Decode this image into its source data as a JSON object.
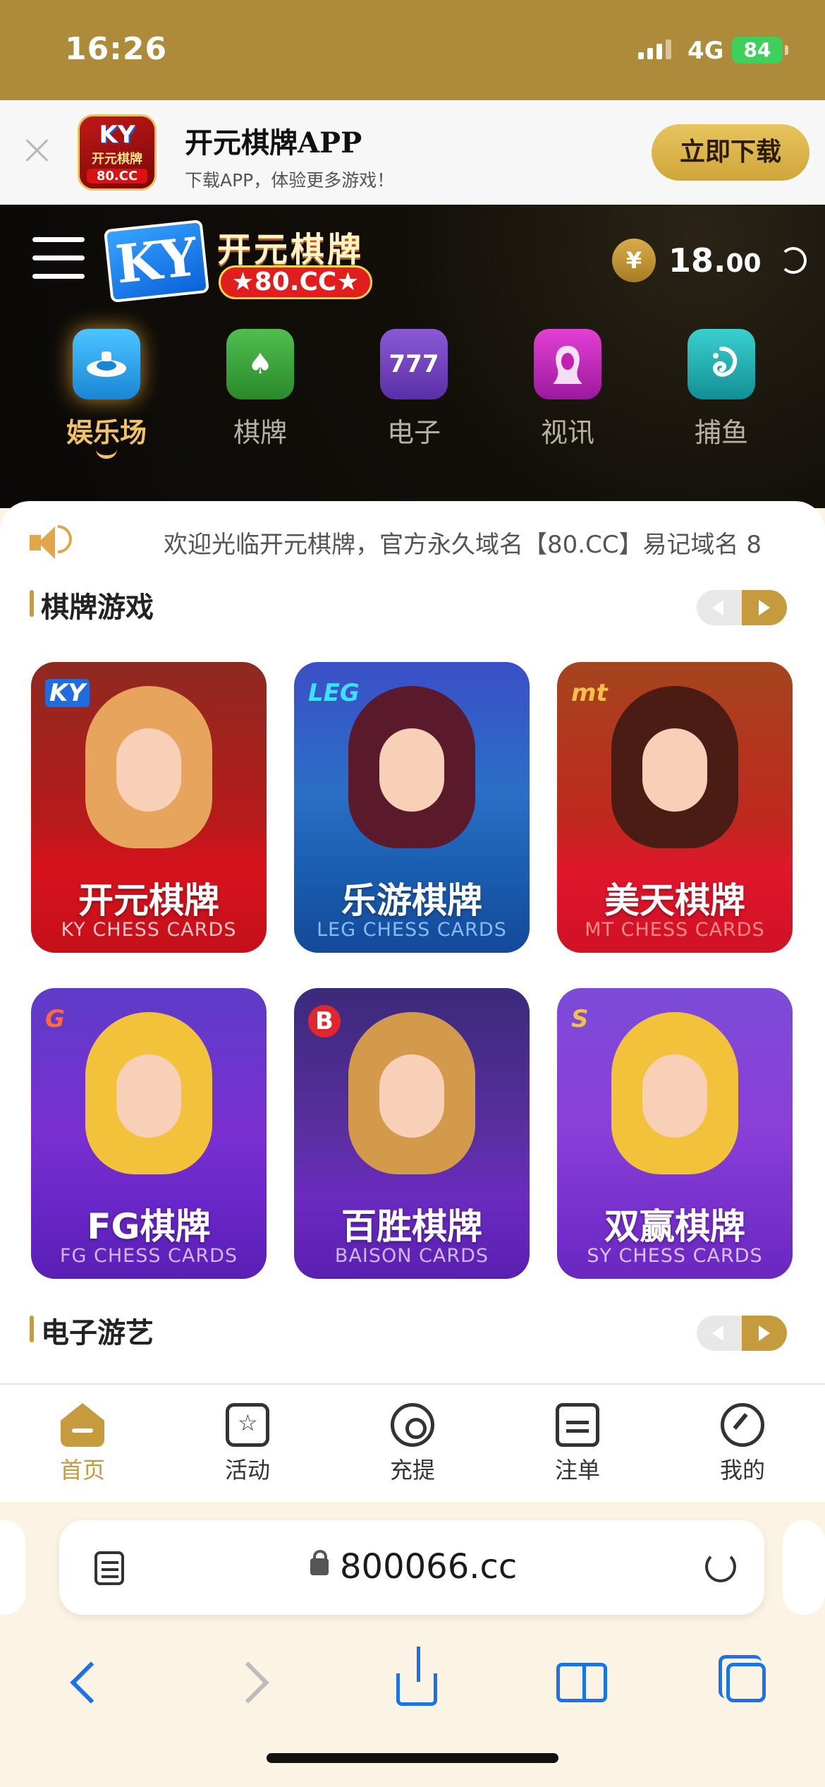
{
  "status_bar": {
    "time": "16:26",
    "network": "4G",
    "battery": "84"
  },
  "app_banner": {
    "logo_text": "KY",
    "logo_sub": "开元棋牌",
    "logo_cc": "80.CC",
    "title": "开元棋牌APP",
    "subtitle": "下载APP，体验更多游戏！",
    "download_label": "立即下载"
  },
  "header": {
    "brand_ky": "KY",
    "brand_name": "开元棋牌",
    "brand_domain": "★80.CC★",
    "currency_icon": "¥",
    "balance_int": "18.",
    "balance_dec": "00"
  },
  "categories": [
    {
      "label": "娱乐场",
      "icon": "casino-table-icon",
      "color": "#1fa8e6",
      "active": true
    },
    {
      "label": "棋牌",
      "icon": "spade-icon",
      "color": "#3a9c3a"
    },
    {
      "label": "电子",
      "icon": "slot-777-icon",
      "color": "#6b3fb6"
    },
    {
      "label": "视讯",
      "icon": "live-dealer-icon",
      "color": "#c21fb5"
    },
    {
      "label": "捕鱼",
      "icon": "fish-icon",
      "color": "#19b0b0"
    }
  ],
  "notice": {
    "text": "欢迎光临开元棋牌，官方永久域名【80.CC】易记域名 8"
  },
  "sections": {
    "chess_title": "棋牌游戏",
    "slots_title": "电子游艺"
  },
  "games": [
    {
      "name": "开元棋牌",
      "en": "KY CHESS CARDS",
      "provider": "KY",
      "theme": "c-red"
    },
    {
      "name": "乐游棋牌",
      "en": "LEG CHESS CARDS",
      "provider": "LEG",
      "theme": "c-blue"
    },
    {
      "name": "美天棋牌",
      "en": "MT CHESS CARDS",
      "provider": "mt",
      "theme": "c-red2"
    },
    {
      "name": "FG棋牌",
      "en": "FG CHESS CARDS",
      "provider": "G",
      "theme": "c-purple"
    },
    {
      "name": "百胜棋牌",
      "en": "BAISON CARDS",
      "provider": "B",
      "theme": "c-purple2"
    },
    {
      "name": "双赢棋牌",
      "en": "SY CHESS CARDS",
      "provider": "S",
      "theme": "c-purple3"
    }
  ],
  "tabbar": [
    {
      "label": "首页",
      "icon": "home-icon",
      "active": true
    },
    {
      "label": "活动",
      "icon": "star-badge-icon"
    },
    {
      "label": "充提",
      "icon": "deposit-icon"
    },
    {
      "label": "注单",
      "icon": "order-list-icon"
    },
    {
      "label": "我的",
      "icon": "profile-icon"
    }
  ],
  "browser": {
    "url": "800066.cc"
  },
  "colors": {
    "gold": "#c59b3e",
    "status_bar": "#ad8b3b",
    "header_bg": "#0b0907"
  }
}
